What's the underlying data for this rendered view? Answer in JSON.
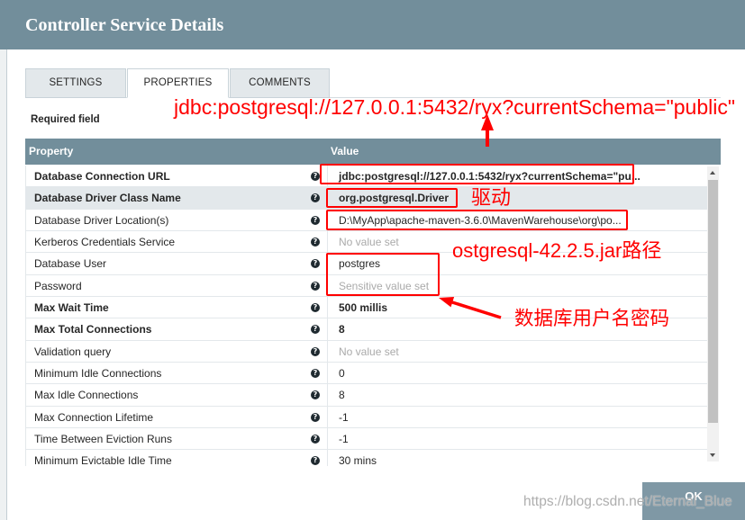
{
  "window": {
    "title": "Controller Service Details"
  },
  "tabs": [
    {
      "label": "SETTINGS",
      "selected": false
    },
    {
      "label": "PROPERTIES",
      "selected": true
    },
    {
      "label": "COMMENTS",
      "selected": false
    }
  ],
  "required_field_label": "Required field",
  "table": {
    "columns": [
      "Property",
      "Value"
    ],
    "rows": [
      {
        "property": "Database Connection URL",
        "value": "jdbc:postgresql://127.0.0.1:5432/ryx?currentSchema=\"pu...",
        "required": true
      },
      {
        "property": "Database Driver Class Name",
        "value": "org.postgresql.Driver",
        "required": true,
        "highlighted": true
      },
      {
        "property": "Database Driver Location(s)",
        "value": "D:\\MyApp\\apache-maven-3.6.0\\MavenWarehouse\\org\\po..."
      },
      {
        "property": "Kerberos Credentials Service",
        "value": "No value set",
        "placeholder": true
      },
      {
        "property": "Database User",
        "value": "postgres"
      },
      {
        "property": "Password",
        "value": "Sensitive value set",
        "placeholder": true
      },
      {
        "property": "Max Wait Time",
        "value": "500 millis",
        "required": true
      },
      {
        "property": "Max Total Connections",
        "value": "8",
        "required": true
      },
      {
        "property": "Validation query",
        "value": "No value set",
        "placeholder": true
      },
      {
        "property": "Minimum Idle Connections",
        "value": "0"
      },
      {
        "property": "Max Idle Connections",
        "value": "8"
      },
      {
        "property": "Max Connection Lifetime",
        "value": "-1"
      },
      {
        "property": "Time Between Eviction Runs",
        "value": "-1"
      },
      {
        "property": "Minimum Evictable Idle Time",
        "value": "30 mins"
      }
    ]
  },
  "annotations": {
    "url_note": "jdbc:postgresql://127.0.0.1:5432/ryx?currentSchema=\"public\"",
    "driver_note": "驱动",
    "jar_path_note": "ostgresql-42.2.5.jar路径",
    "credentials_note": "数据库用户名密码"
  },
  "footer": {
    "ok_label": "OK"
  },
  "watermark": "https://blog.csdn.net/Eternal_Blue",
  "icons": {
    "help": "question-circle-icon",
    "scroll_up": "scroll-up-arrow-icon",
    "scroll_down": "scroll-down-arrow-icon"
  },
  "colors": {
    "header": "#728e9b",
    "tab_inactive": "#e3e8eb",
    "row_highlight": "#e3e8eb",
    "annotation": "#ff0000",
    "text": "#262626",
    "placeholder_text": "#aaaaaa",
    "help_icon": "#1f2a30",
    "button": "#7f98a5"
  }
}
